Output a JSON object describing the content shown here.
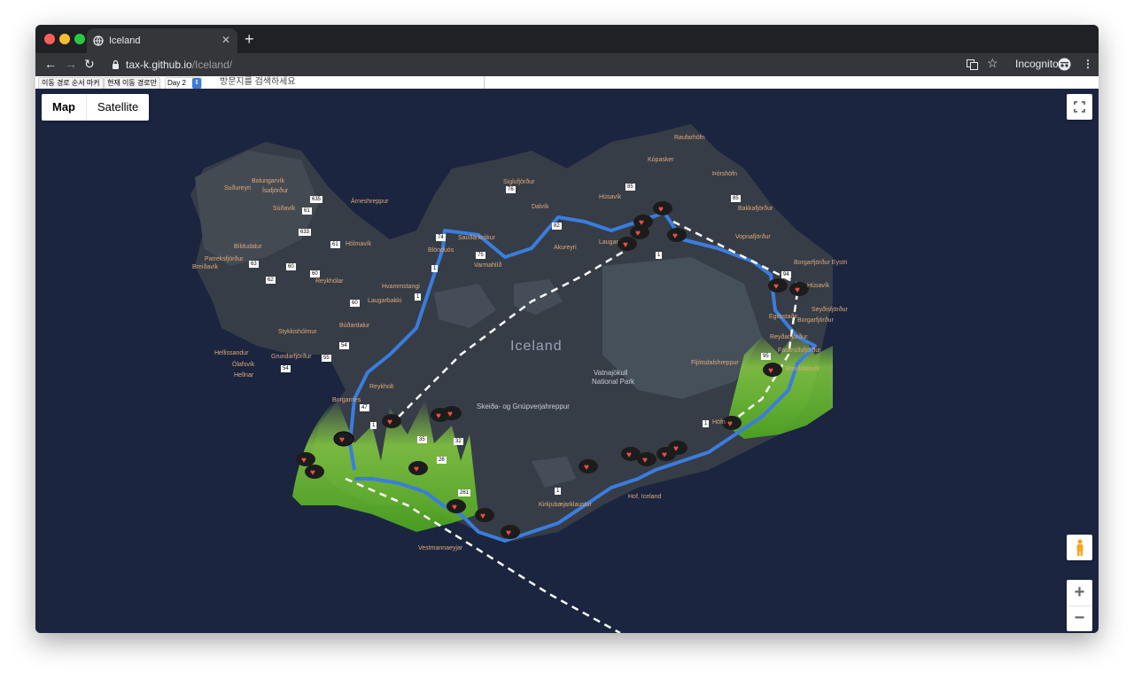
{
  "browser": {
    "tab_title": "Iceland",
    "tab_close": "✕",
    "new_tab": "+",
    "url_host": "tax-k.github.io",
    "url_path": "/Iceland/",
    "profile_label": "Incognito",
    "nav": {
      "back": "←",
      "forward": "→",
      "reload": "↻"
    }
  },
  "controls": {
    "route_order_marker": "이동 경로 순서 마커",
    "current_route_only": "현재 이동 경로만",
    "day_select_value": "Day 2",
    "search_placeholder": "방문지를 검색하세요"
  },
  "map": {
    "type_map": "Map",
    "type_satellite": "Satellite",
    "zoom_in": "+",
    "zoom_out": "−",
    "country_label": "Iceland",
    "glacier_label_1": "Vatnajökull",
    "glacier_label_2": "National Park",
    "place_labels": [
      "Raufarhöfn",
      "Kópasker",
      "Þórshöfn",
      "Bakkafjörður",
      "Húsavík",
      "Siglufjörður",
      "Dalvík",
      "Bolungarvík",
      "Ísafjörður",
      "Suðureyri",
      "Súðavík",
      "Árneshreppur",
      "Hólmavík",
      "Bíldudalur",
      "Patreksfjörður",
      "Breiðavík",
      "Reykhólar",
      "Sauðárkrókur",
      "Blönduós",
      "Varmahlíð",
      "Akureyri",
      "Laugar",
      "Vopnafjörður",
      "Borgarfjörður Eystri",
      "Húsavík",
      "Hvammstangi",
      "Laugarbakki",
      "Búðardalur",
      "Stykkishólmur",
      "Hellissandur",
      "Ólafsvík",
      "Hellnar",
      "Grundarfjörður",
      "Reykholt",
      "Borgarnes",
      "Skeiða- og Gnúpverjahreppur",
      "Fljótsdalshreppur",
      "Reyðarfjörður",
      "Fáskrúðsfjörður",
      "Breiðdalsvík",
      "Höfn",
      "Kirkjubæjarklaustur",
      "Hof, Iceland",
      "Vestmannaeyjar",
      "Egilsstaðir",
      "Seyðisfjörður",
      "Borgarfjörður"
    ],
    "road_shields": [
      "635",
      "61",
      "633",
      "61",
      "60",
      "63",
      "60",
      "62",
      "60",
      "54",
      "55",
      "54",
      "74",
      "75",
      "1",
      "1",
      "82",
      "76",
      "85",
      "85",
      "94",
      "1",
      "95",
      "1",
      "47",
      "35",
      "32",
      "26",
      "261",
      "1",
      "1"
    ]
  },
  "colors": {
    "map_bg": "#1b2540",
    "land": "#3a4048",
    "route": "#3b7ddd",
    "aurora": "#7bd33a",
    "marker": "#e8504a"
  }
}
